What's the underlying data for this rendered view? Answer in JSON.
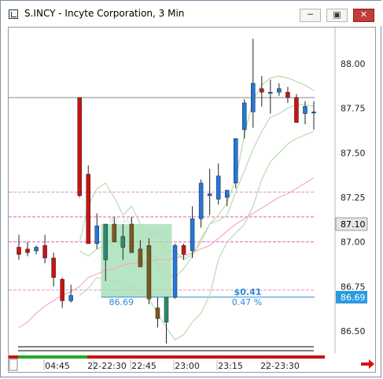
{
  "window": {
    "title": "S.INCY - Incyte Corporation, 3 Min",
    "buttons": {
      "minimize": "─",
      "restore": "▣",
      "close": "✕"
    }
  },
  "chart_data": {
    "type": "candlestick",
    "ylim": [
      86.4,
      88.25
    ],
    "y_ticks": [
      "88.00",
      "87.75",
      "87.50",
      "87.25",
      "87.00",
      "86.75",
      "86.50"
    ],
    "x_ticks": [
      "04:45",
      "22-22:30",
      "22:45",
      "23:00",
      "23:15",
      "22-23:30"
    ],
    "last_price_label": "87.10",
    "marker_price_label": "86.69",
    "horizontal_levels": [
      {
        "value": 87.81,
        "color": "#888888"
      },
      {
        "value": 87.28,
        "color": "#e090c8"
      },
      {
        "value": 87.14,
        "color": "#e060b0"
      },
      {
        "value": 87.0,
        "color": "#e060b0"
      },
      {
        "value": 86.73,
        "color": "#e090c8"
      }
    ],
    "measure_box": {
      "start_price": 86.69,
      "start_label": "86.69",
      "change_label": "$0.41",
      "pct_label": "0.47 %",
      "top_label": "87.10",
      "end_price": 87.1
    },
    "candles": [
      {
        "o": 86.97,
        "h": 87.04,
        "l": 86.9,
        "c": 86.93
      },
      {
        "o": 86.96,
        "h": 87.0,
        "l": 86.92,
        "c": 86.94
      },
      {
        "o": 86.95,
        "h": 86.98,
        "l": 86.93,
        "c": 86.97
      },
      {
        "o": 86.98,
        "h": 87.04,
        "l": 86.88,
        "c": 86.91
      },
      {
        "o": 86.91,
        "h": 86.94,
        "l": 86.75,
        "c": 86.8
      },
      {
        "o": 86.79,
        "h": 86.8,
        "l": 86.63,
        "c": 86.67
      },
      {
        "o": 86.67,
        "h": 86.76,
        "l": 86.66,
        "c": 86.7
      },
      {
        "o": 87.81,
        "h": 87.81,
        "l": 87.25,
        "c": 87.26
      },
      {
        "o": 87.38,
        "h": 87.43,
        "l": 86.99,
        "c": 86.99
      },
      {
        "o": 86.99,
        "h": 87.16,
        "l": 86.96,
        "c": 87.09
      },
      {
        "o": 86.9,
        "h": 87.1,
        "l": 86.78,
        "c": 87.1
      },
      {
        "o": 87.1,
        "h": 87.14,
        "l": 87.0,
        "c": 87.0
      },
      {
        "o": 86.97,
        "h": 87.1,
        "l": 86.9,
        "c": 87.03
      },
      {
        "o": 87.1,
        "h": 87.14,
        "l": 86.94,
        "c": 86.94
      },
      {
        "o": 86.96,
        "h": 87.01,
        "l": 86.89,
        "c": 86.86
      },
      {
        "o": 86.98,
        "h": 87.02,
        "l": 86.65,
        "c": 86.68
      },
      {
        "o": 86.63,
        "h": 86.69,
        "l": 86.52,
        "c": 86.57
      },
      {
        "o": 86.55,
        "h": 86.69,
        "l": 86.43,
        "c": 86.69
      },
      {
        "o": 86.69,
        "h": 86.99,
        "l": 86.68,
        "c": 86.98
      },
      {
        "o": 86.98,
        "h": 86.99,
        "l": 86.9,
        "c": 86.93
      },
      {
        "o": 86.95,
        "h": 87.2,
        "l": 86.91,
        "c": 87.13
      },
      {
        "o": 87.13,
        "h": 87.35,
        "l": 87.08,
        "c": 87.33
      },
      {
        "o": 87.26,
        "h": 87.41,
        "l": 87.15,
        "c": 87.27
      },
      {
        "o": 87.24,
        "h": 87.44,
        "l": 87.21,
        "c": 87.37
      },
      {
        "o": 87.25,
        "h": 87.29,
        "l": 87.2,
        "c": 87.29
      },
      {
        "o": 87.33,
        "h": 87.58,
        "l": 87.3,
        "c": 87.58
      },
      {
        "o": 87.63,
        "h": 87.8,
        "l": 87.58,
        "c": 87.78
      },
      {
        "o": 87.73,
        "h": 88.14,
        "l": 87.64,
        "c": 87.89
      },
      {
        "o": 87.86,
        "h": 87.93,
        "l": 87.76,
        "c": 87.84
      },
      {
        "o": 87.84,
        "h": 87.91,
        "l": 87.72,
        "c": 87.84
      },
      {
        "o": 87.84,
        "h": 87.89,
        "l": 87.82,
        "c": 87.86
      },
      {
        "o": 87.84,
        "h": 87.87,
        "l": 87.78,
        "c": 87.81
      },
      {
        "o": 87.81,
        "h": 87.83,
        "l": 87.68,
        "c": 87.67
      },
      {
        "o": 87.72,
        "h": 87.79,
        "l": 87.66,
        "c": 87.76
      },
      {
        "o": 87.73,
        "h": 87.79,
        "l": 87.63,
        "c": 87.73
      }
    ],
    "bollinger_upper": [
      null,
      null,
      null,
      null,
      null,
      null,
      null,
      87.0,
      87.2,
      87.3,
      87.33,
      87.25,
      87.15,
      87.2,
      87.1,
      87.05,
      87.05,
      86.95,
      86.95,
      86.9,
      86.93,
      87.0,
      87.1,
      87.15,
      87.22,
      87.35,
      87.6,
      87.8,
      87.88,
      87.92,
      87.93,
      87.92,
      87.9,
      87.88,
      87.85
    ],
    "bollinger_lower": [
      null,
      null,
      null,
      null,
      null,
      null,
      null,
      86.7,
      86.74,
      86.8,
      86.79,
      86.78,
      86.77,
      86.75,
      86.72,
      86.68,
      86.6,
      86.52,
      86.45,
      86.48,
      86.55,
      86.6,
      86.7,
      86.9,
      87.0,
      87.05,
      87.1,
      87.2,
      87.35,
      87.45,
      87.5,
      87.55,
      87.58,
      87.6,
      87.62
    ],
    "mid_band": [
      null,
      null,
      null,
      null,
      null,
      null,
      null,
      86.95,
      86.92,
      86.96,
      86.98,
      87.0,
      86.98,
      86.98,
      86.97,
      86.95,
      86.88,
      86.82,
      86.8,
      86.85,
      86.92,
      87.02,
      87.1,
      87.12,
      87.15,
      87.28,
      87.4,
      87.52,
      87.62,
      87.7,
      87.72,
      87.75,
      87.77,
      87.77,
      87.76
    ],
    "moving_average": [
      86.52,
      86.55,
      86.6,
      86.64,
      86.67,
      86.7,
      86.72,
      86.75,
      86.8,
      86.82,
      86.84,
      86.85,
      86.87,
      86.88,
      86.88,
      86.89,
      86.9,
      86.9,
      86.91,
      86.92,
      86.94,
      86.96,
      86.98,
      87.02,
      87.06,
      87.1,
      87.13,
      87.16,
      87.19,
      87.22,
      87.25,
      87.27,
      87.3,
      87.33,
      87.36
    ],
    "colors": {
      "up": "#2277dd",
      "down": "#cc1111",
      "up_shaded": "#2a8a70",
      "down_shaded": "#7a5a20",
      "bb": "#b8dcb0",
      "ma": "#f5a8c8",
      "measure": "#9edcb0"
    }
  }
}
